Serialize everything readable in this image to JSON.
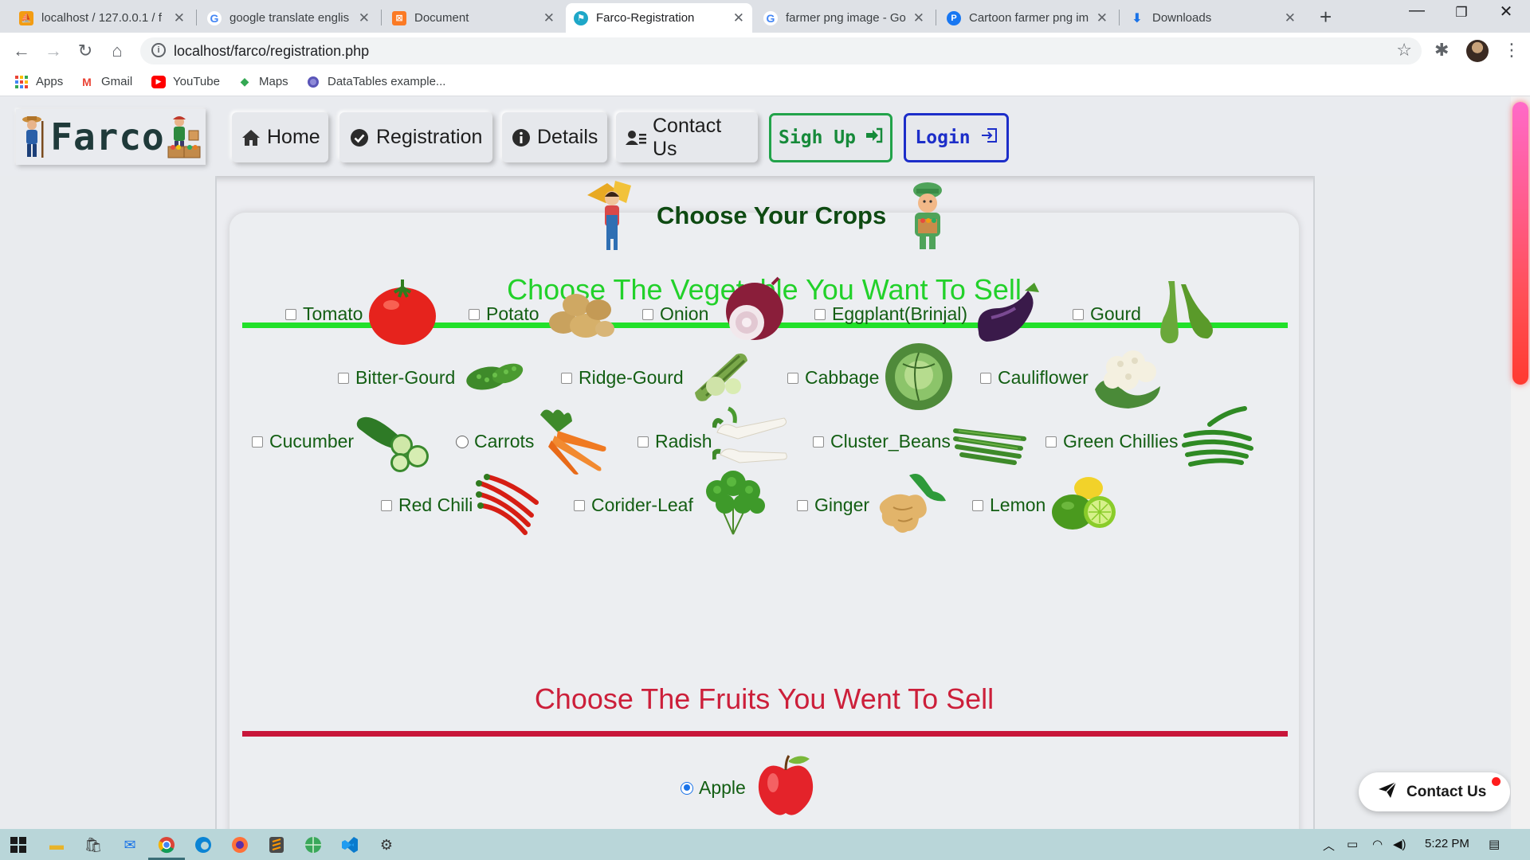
{
  "browser": {
    "tabs": [
      {
        "title": "localhost / 127.0.0.1 / f",
        "favicon": "phpmyadmin-icon"
      },
      {
        "title": "google translate englis",
        "favicon": "google-icon"
      },
      {
        "title": "Document",
        "favicon": "xampp-icon"
      },
      {
        "title": "Farco-Registration",
        "favicon": "farco-icon",
        "active": true
      },
      {
        "title": "farmer png image - Go",
        "favicon": "google-icon"
      },
      {
        "title": "Cartoon farmer png im",
        "favicon": "pinterest-icon"
      },
      {
        "title": "Downloads",
        "favicon": "download-icon"
      }
    ],
    "new_tab": "+",
    "window_controls": {
      "minimize": "—",
      "maximize": "❐",
      "close": "✕"
    },
    "url": "localhost/farco/registration.php",
    "bookmarks": [
      "Apps",
      "Gmail",
      "YouTube",
      "Maps",
      "DataTables example..."
    ]
  },
  "site": {
    "logo": "Farco",
    "nav": [
      {
        "label": "Home",
        "icon": "home-icon"
      },
      {
        "label": "Registration",
        "icon": "check-circle-icon"
      },
      {
        "label": "Details",
        "icon": "info-icon"
      },
      {
        "label": "Contact Us",
        "icon": "contact-card-icon"
      }
    ],
    "signup": "Sigh Up",
    "login": "Login"
  },
  "page": {
    "heading": "Choose Your Crops",
    "veg_title": "Choose The Vegetable You Want To Sell",
    "fruit_title": "Choose The Fruits You Went To Sell",
    "vegetables": [
      {
        "label": "Tomato",
        "image": "tomato"
      },
      {
        "label": "Potato",
        "image": "potato"
      },
      {
        "label": "Onion",
        "image": "onion"
      },
      {
        "label": "Eggplant(Brinjal)",
        "image": "eggplant"
      },
      {
        "label": "Gourd",
        "image": "gourd"
      },
      {
        "label": "Bitter-Gourd",
        "image": "bitter-gourd"
      },
      {
        "label": "Ridge-Gourd",
        "image": "ridge-gourd"
      },
      {
        "label": "Cabbage",
        "image": "cabbage"
      },
      {
        "label": "Cauliflower",
        "image": "cauliflower"
      },
      {
        "label": "Cucumber",
        "image": "cucumber"
      },
      {
        "label": "Carrots",
        "image": "carrot",
        "input": "radio"
      },
      {
        "label": "Radish",
        "image": "radish"
      },
      {
        "label": "Cluster_Beans",
        "image": "beans"
      },
      {
        "label": "Green Chillies",
        "image": "green-chilli"
      },
      {
        "label": "Red Chili",
        "image": "red-chili"
      },
      {
        "label": "Corider-Leaf",
        "image": "coriander"
      },
      {
        "label": "Ginger",
        "image": "ginger"
      },
      {
        "label": "Lemon",
        "image": "lemon"
      }
    ],
    "fruits": [
      {
        "label": "Apple",
        "image": "apple",
        "input": "radio",
        "checked": true
      }
    ],
    "contact_float": "Contact Us"
  },
  "taskbar": {
    "time": "5:22 PM"
  },
  "colors": {
    "veg_green": "#22d12a",
    "fruit_red": "#cc1f3a",
    "label_green": "#135e13",
    "signup_green": "#168a3a",
    "login_blue": "#1d2ec9"
  }
}
